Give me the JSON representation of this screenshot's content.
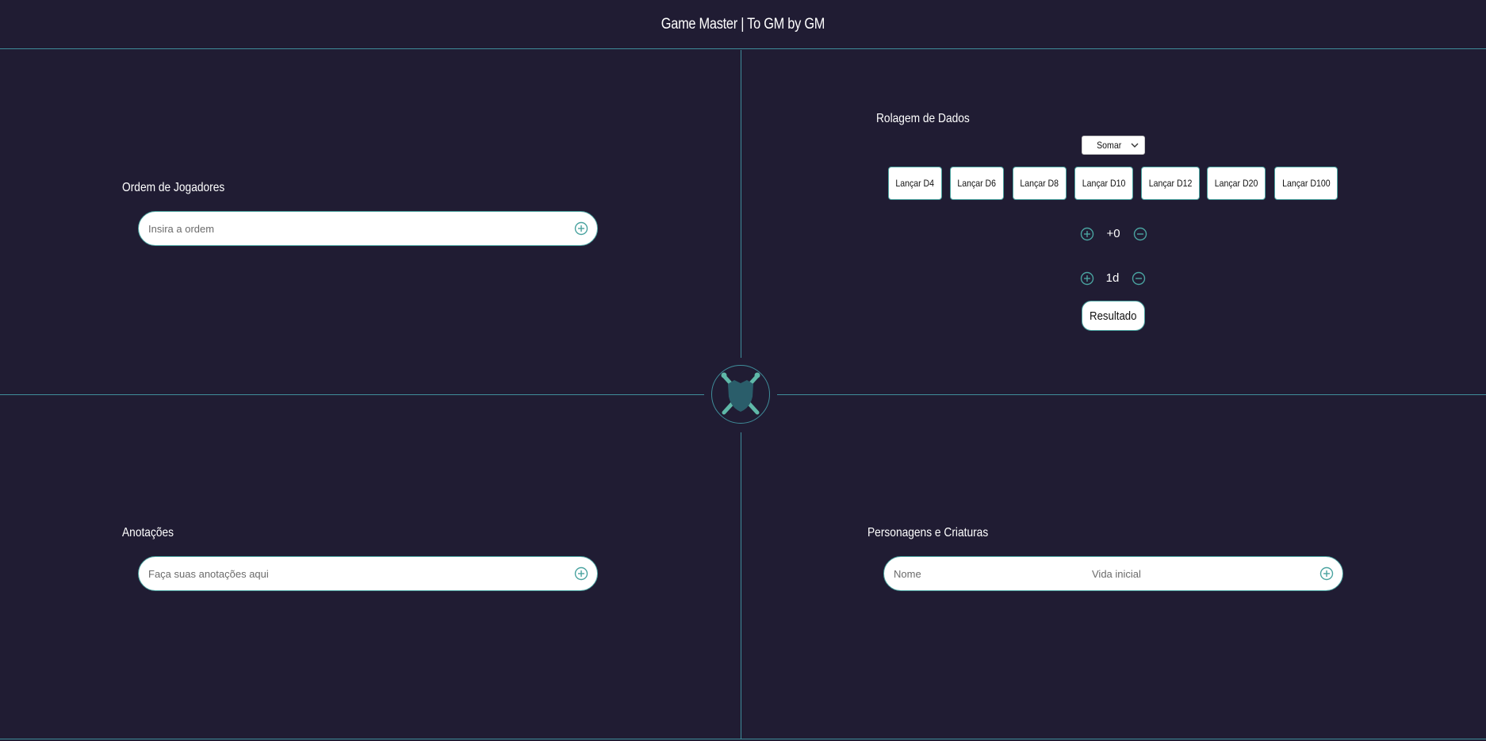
{
  "header": {
    "title": "Game Master | To GM by GM"
  },
  "players": {
    "title": "Ordem de Jogadores",
    "input_placeholder": "Insira a ordem"
  },
  "dice": {
    "title": "Rolagem de Dados",
    "mode_selected": "Somar",
    "buttons": [
      "Lançar D4",
      "Lançar D6",
      "Lançar D8",
      "Lançar D10",
      "Lançar D12",
      "Lançar D20",
      "Lançar D100"
    ],
    "modifier": "+0",
    "count": "1d",
    "result_label": "Resultado"
  },
  "notes": {
    "title": "Anotações",
    "input_placeholder": "Faça suas anotações aqui"
  },
  "characters": {
    "title": "Personagens e Criaturas",
    "name_placeholder": "Nome",
    "hp_placeholder": "Vida inicial"
  },
  "colors": {
    "background": "#201c33",
    "accent": "#3f8d9a",
    "icon_green": "#4aa3a0",
    "emblem_shield": "#2a5d6a",
    "emblem_sword": "#5fb8a8"
  }
}
